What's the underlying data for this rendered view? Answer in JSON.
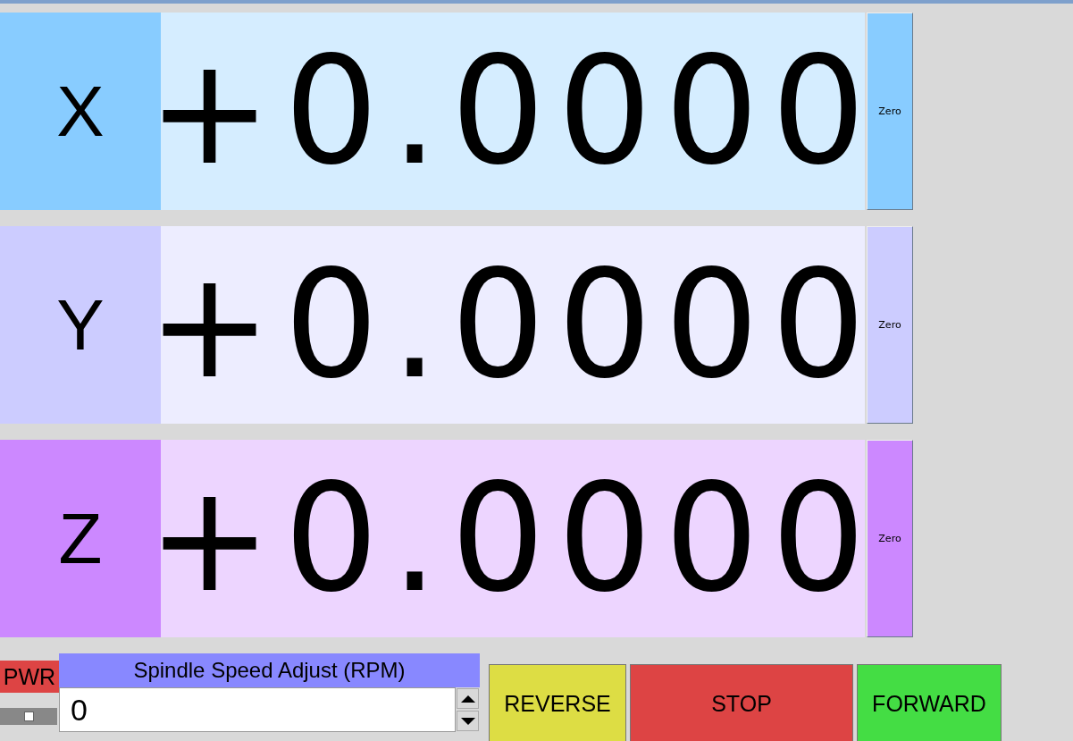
{
  "axes": [
    {
      "label": "X",
      "value": "+0.0000",
      "zero_button": "Zero",
      "color": "#88ccff"
    },
    {
      "label": "Y",
      "value": "+0.0000",
      "zero_button": "Zero",
      "color": "#ccccff"
    },
    {
      "label": "Z",
      "value": "+0.0000",
      "zero_button": "Zero",
      "color": "#cc88ff"
    }
  ],
  "power": {
    "label": "PWR"
  },
  "spindle": {
    "title": "Spindle Speed Adjust (RPM)",
    "value": "0"
  },
  "buttons": [
    {
      "label": "REVERSE",
      "color": "#dddd44"
    },
    {
      "label": "STOP",
      "color": "#dd4444"
    },
    {
      "label": "FORWARD",
      "color": "#44dd44"
    }
  ]
}
